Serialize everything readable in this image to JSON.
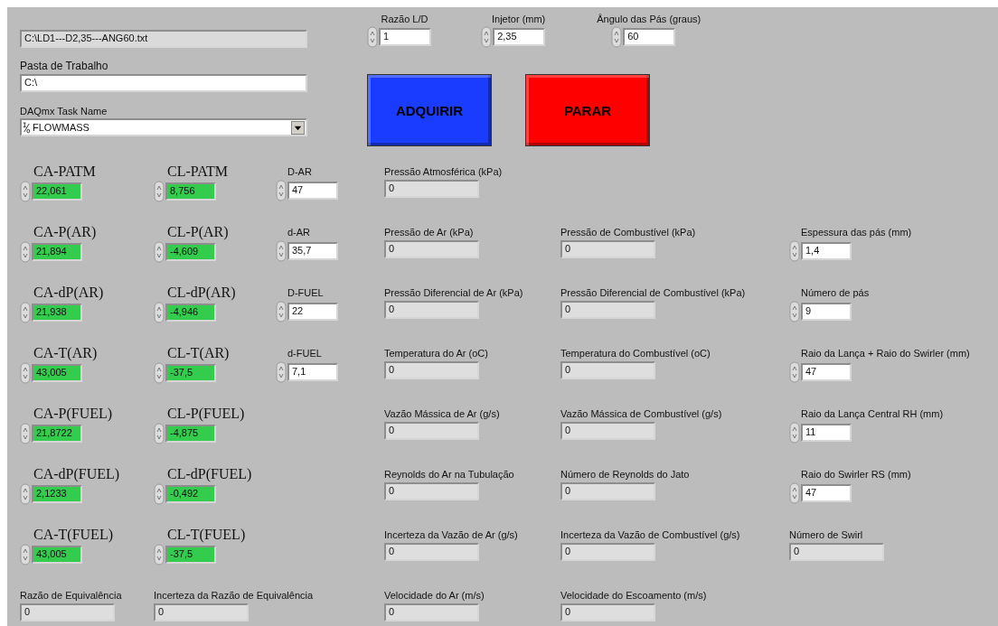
{
  "file_path": {
    "value": "C:\\LD1---D2,35---ANG60.txt"
  },
  "working_folder": {
    "label": "Pasta de Trabalho",
    "value": "C:\\"
  },
  "daqmx_task": {
    "label": "DAQmx Task Name",
    "value": "FLOWMASS"
  },
  "parameters": [
    {
      "label": "Razão L/D",
      "value": "1"
    },
    {
      "label": "Injetor (mm)",
      "value": "2,35"
    },
    {
      "label": "Ângulo das Pás (graus)",
      "value": "60"
    }
  ],
  "buttons": [
    {
      "label": "ADQUIRIR",
      "color": "#1a3cff"
    },
    {
      "label": "PARAR",
      "color": "#ff0000"
    }
  ],
  "columns": [
    {
      "controls": [
        {
          "kind": "reading",
          "label": "CA-PATM",
          "value": "22,061"
        },
        {
          "kind": "reading",
          "label": "CA-P(AR)",
          "value": "21,894"
        },
        {
          "kind": "reading",
          "label": "CA-dP(AR)",
          "value": "21,938"
        },
        {
          "kind": "reading",
          "label": "CA-T(AR)",
          "value": "43,005"
        },
        {
          "kind": "reading",
          "label": "CA-P(FUEL)",
          "value": "21,8722"
        },
        {
          "kind": "reading",
          "label": "CA-dP(FUEL)",
          "value": "2,1233"
        },
        {
          "kind": "reading",
          "label": "CA-T(FUEL)",
          "value": "43,005"
        },
        {
          "kind": "indicator",
          "label": "Razão de Equivalência",
          "value": "0"
        }
      ]
    },
    {
      "controls": [
        {
          "kind": "reading",
          "label": "CL-PATM",
          "value": "8,756"
        },
        {
          "kind": "reading",
          "label": "CL-P(AR)",
          "value": "-4,609"
        },
        {
          "kind": "reading",
          "label": "CL-dP(AR)",
          "value": "-4,946"
        },
        {
          "kind": "reading",
          "label": "CL-T(AR)",
          "value": "-37,5"
        },
        {
          "kind": "reading",
          "label": "CL-P(FUEL)",
          "value": "-4,875"
        },
        {
          "kind": "reading",
          "label": "CL-dP(FUEL)",
          "value": "-0,492"
        },
        {
          "kind": "reading",
          "label": "CL-T(FUEL)",
          "value": "-37,5"
        },
        {
          "kind": "indicator",
          "label": "Incerteza da Razão de Equivalência",
          "value": "0"
        }
      ]
    },
    {
      "controls": [
        {
          "kind": "control",
          "label": "D-AR",
          "value": "47"
        },
        {
          "kind": "control",
          "label": "d-AR",
          "value": "35,7"
        },
        {
          "kind": "control",
          "label": "D-FUEL",
          "value": "22"
        },
        {
          "kind": "control",
          "label": "d-FUEL",
          "value": "7,1"
        }
      ]
    },
    {
      "controls": [
        {
          "kind": "indicator",
          "label": "Pressão Atmosférica (kPa)",
          "value": "0"
        },
        {
          "kind": "indicator",
          "label": "Pressão de Ar (kPa)",
          "value": "0"
        },
        {
          "kind": "indicator",
          "label": "Pressão Diferencial de Ar (kPa)",
          "value": "0"
        },
        {
          "kind": "indicator",
          "label": "Temperatura do Ar (oC)",
          "value": "0"
        },
        {
          "kind": "indicator",
          "label": "Vazão Mássica de Ar (g/s)",
          "value": "0"
        },
        {
          "kind": "indicator",
          "label": "Reynolds do Ar na Tubulação",
          "value": "0"
        },
        {
          "kind": "indicator",
          "label": "Incerteza da Vazão de Ar (g/s)",
          "value": "0"
        },
        {
          "kind": "indicator",
          "label": "Velocidade do Ar (m/s)",
          "value": "0"
        }
      ]
    },
    {
      "controls": [
        {
          "kind": "indicator",
          "label": "Pressão de Combustível (kPa)",
          "value": "0"
        },
        {
          "kind": "indicator",
          "label": "Pressão Diferencial de Combustível (kPa)",
          "value": "0"
        },
        {
          "kind": "indicator",
          "label": "Temperatura do Combustível (oC)",
          "value": "0"
        },
        {
          "kind": "indicator",
          "label": "Vazão Mássica de Combustível (g/s)",
          "value": "0"
        },
        {
          "kind": "indicator",
          "label": "Número de Reynolds do Jato",
          "value": "0"
        },
        {
          "kind": "indicator",
          "label": "Incerteza da Vazão de Combustível (g/s)",
          "value": "0"
        },
        {
          "kind": "indicator",
          "label": "Velocidade do Escoamento (m/s)",
          "value": "0"
        }
      ]
    },
    {
      "controls": [
        {
          "kind": "control",
          "label": "Espessura das pás (mm)",
          "value": "1,4"
        },
        {
          "kind": "control",
          "label": "Número de pás",
          "value": "9"
        },
        {
          "kind": "control",
          "label": "Raio da Lança + Raio do Swirler (mm)",
          "value": "47"
        },
        {
          "kind": "control",
          "label": "Raio da Lança Central RH (mm)",
          "value": "11"
        },
        {
          "kind": "control",
          "label": "Raio do Swirler RS (mm)",
          "value": "47"
        },
        {
          "kind": "indicator",
          "label": "Número de Swirl",
          "value": "0"
        }
      ]
    }
  ]
}
